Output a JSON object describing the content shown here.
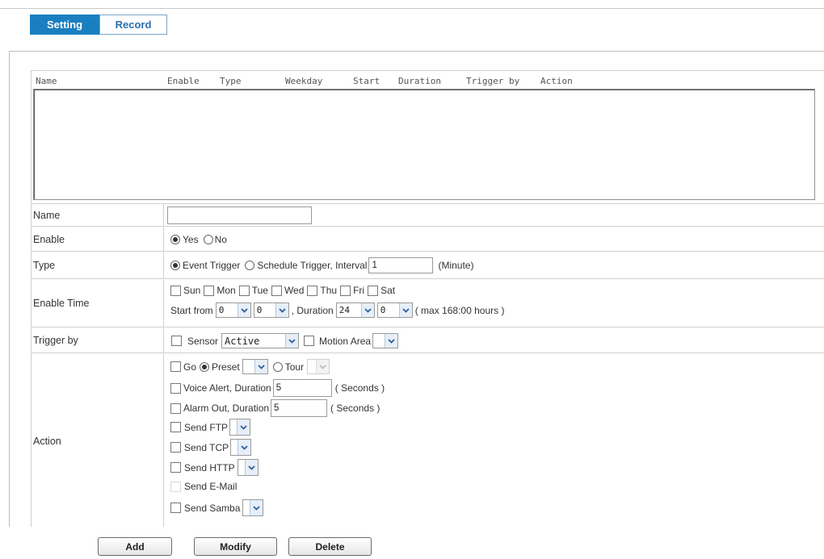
{
  "tabs": {
    "setting": "Setting",
    "record": "Record"
  },
  "list_columns": {
    "name": "Name",
    "enable": "Enable",
    "type": "Type",
    "weekday": "Weekday",
    "start": "Start",
    "duration": "Duration",
    "trigger_by": "Trigger by",
    "action": "Action"
  },
  "form": {
    "name": {
      "label": "Name",
      "value": ""
    },
    "enable": {
      "label": "Enable",
      "yes": "Yes",
      "no": "No",
      "selected": "Yes"
    },
    "type": {
      "label": "Type",
      "event": "Event Trigger",
      "schedule": "Schedule Trigger, Interval",
      "interval_value": "1",
      "unit": "(Minute)",
      "selected": "Event Trigger"
    },
    "enable_time": {
      "label": "Enable Time",
      "days": [
        "Sun",
        "Mon",
        "Tue",
        "Wed",
        "Thu",
        "Fri",
        "Sat"
      ],
      "start_from": "Start from",
      "start_hour": "0",
      "start_min": "0",
      "duration": ", Duration",
      "duration_hour": "24",
      "duration_min": "0",
      "max_note": "( max 168:00 hours )"
    },
    "trigger_by": {
      "label": "Trigger by",
      "sensor": "Sensor",
      "sensor_value": "Active",
      "motion_area": "Motion Area",
      "motion_value": ""
    },
    "action": {
      "label": "Action",
      "go": "Go",
      "preset": "Preset",
      "tour": "Tour",
      "voice_alert": "Voice Alert, Duration",
      "voice_value": "5",
      "voice_unit": "( Seconds )",
      "alarm_out": "Alarm Out, Duration",
      "alarm_value": "5",
      "alarm_unit": "( Seconds )",
      "send_ftp": "Send FTP",
      "send_tcp": "Send TCP",
      "send_http": "Send HTTP",
      "send_email": "Send E-Mail",
      "send_samba": "Send Samba"
    }
  },
  "buttons": {
    "add": "Add",
    "modify": "Modify",
    "delete": "Delete"
  }
}
